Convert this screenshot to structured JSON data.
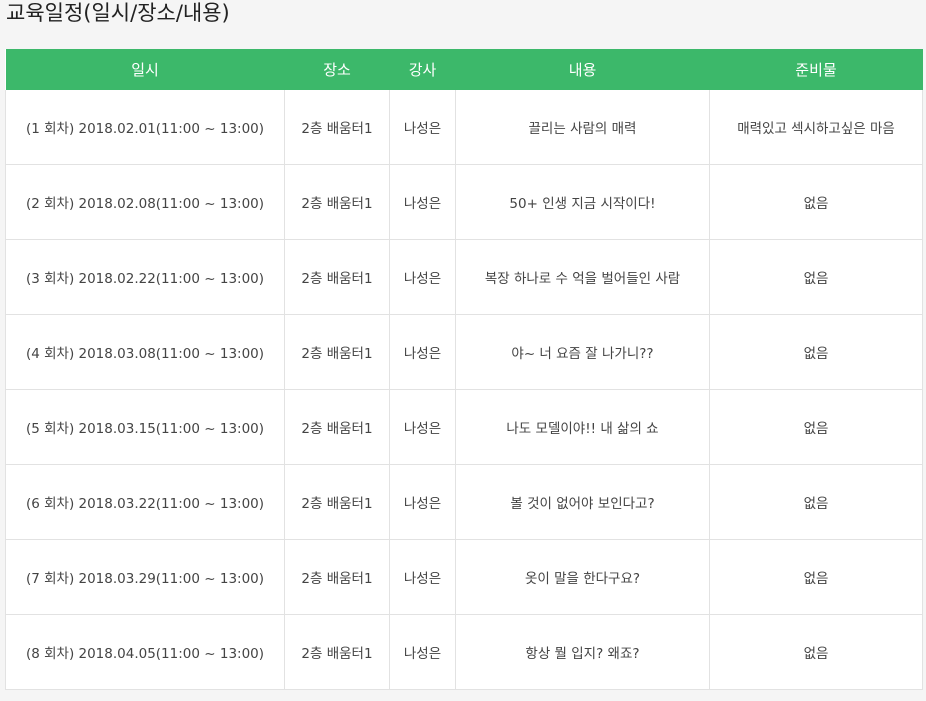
{
  "page": {
    "title": "교육일정(일시/장소/내용)"
  },
  "colors": {
    "header_bg": "#3cb86a",
    "header_text": "#ffffff",
    "border": "#e2e2e2",
    "page_bg": "#f5f5f5"
  },
  "table": {
    "headers": [
      "일시",
      "장소",
      "강사",
      "내용",
      "준비물"
    ],
    "rows": [
      [
        "(1 회차) 2018.02.01(11:00 ~ 13:00)",
        "2층 배움터1",
        "나성은",
        "끌리는 사람의 매력",
        "매력있고 섹시하고싶은 마음"
      ],
      [
        "(2 회차) 2018.02.08(11:00 ~ 13:00)",
        "2층 배움터1",
        "나성은",
        "50+ 인생 지금 시작이다!",
        "없음"
      ],
      [
        "(3 회차) 2018.02.22(11:00 ~ 13:00)",
        "2층 배움터1",
        "나성은",
        "복장 하나로 수 억을 벌어들인 사람",
        "없음"
      ],
      [
        "(4 회차) 2018.03.08(11:00 ~ 13:00)",
        "2층 배움터1",
        "나성은",
        "야~ 너 요즘 잘 나가니??",
        "없음"
      ],
      [
        "(5 회차) 2018.03.15(11:00 ~ 13:00)",
        "2층 배움터1",
        "나성은",
        "나도 모델이야!! 내 삶의 쇼",
        "없음"
      ],
      [
        "(6 회차) 2018.03.22(11:00 ~ 13:00)",
        "2층 배움터1",
        "나성은",
        "볼 것이 없어야 보인다고?",
        "없음"
      ],
      [
        "(7 회차) 2018.03.29(11:00 ~ 13:00)",
        "2층 배움터1",
        "나성은",
        "옷이 말을 한다구요?",
        "없음"
      ],
      [
        "(8 회차) 2018.04.05(11:00 ~ 13:00)",
        "2층 배움터1",
        "나성은",
        "항상 뭘 입지? 왜죠?",
        "없음"
      ]
    ]
  }
}
